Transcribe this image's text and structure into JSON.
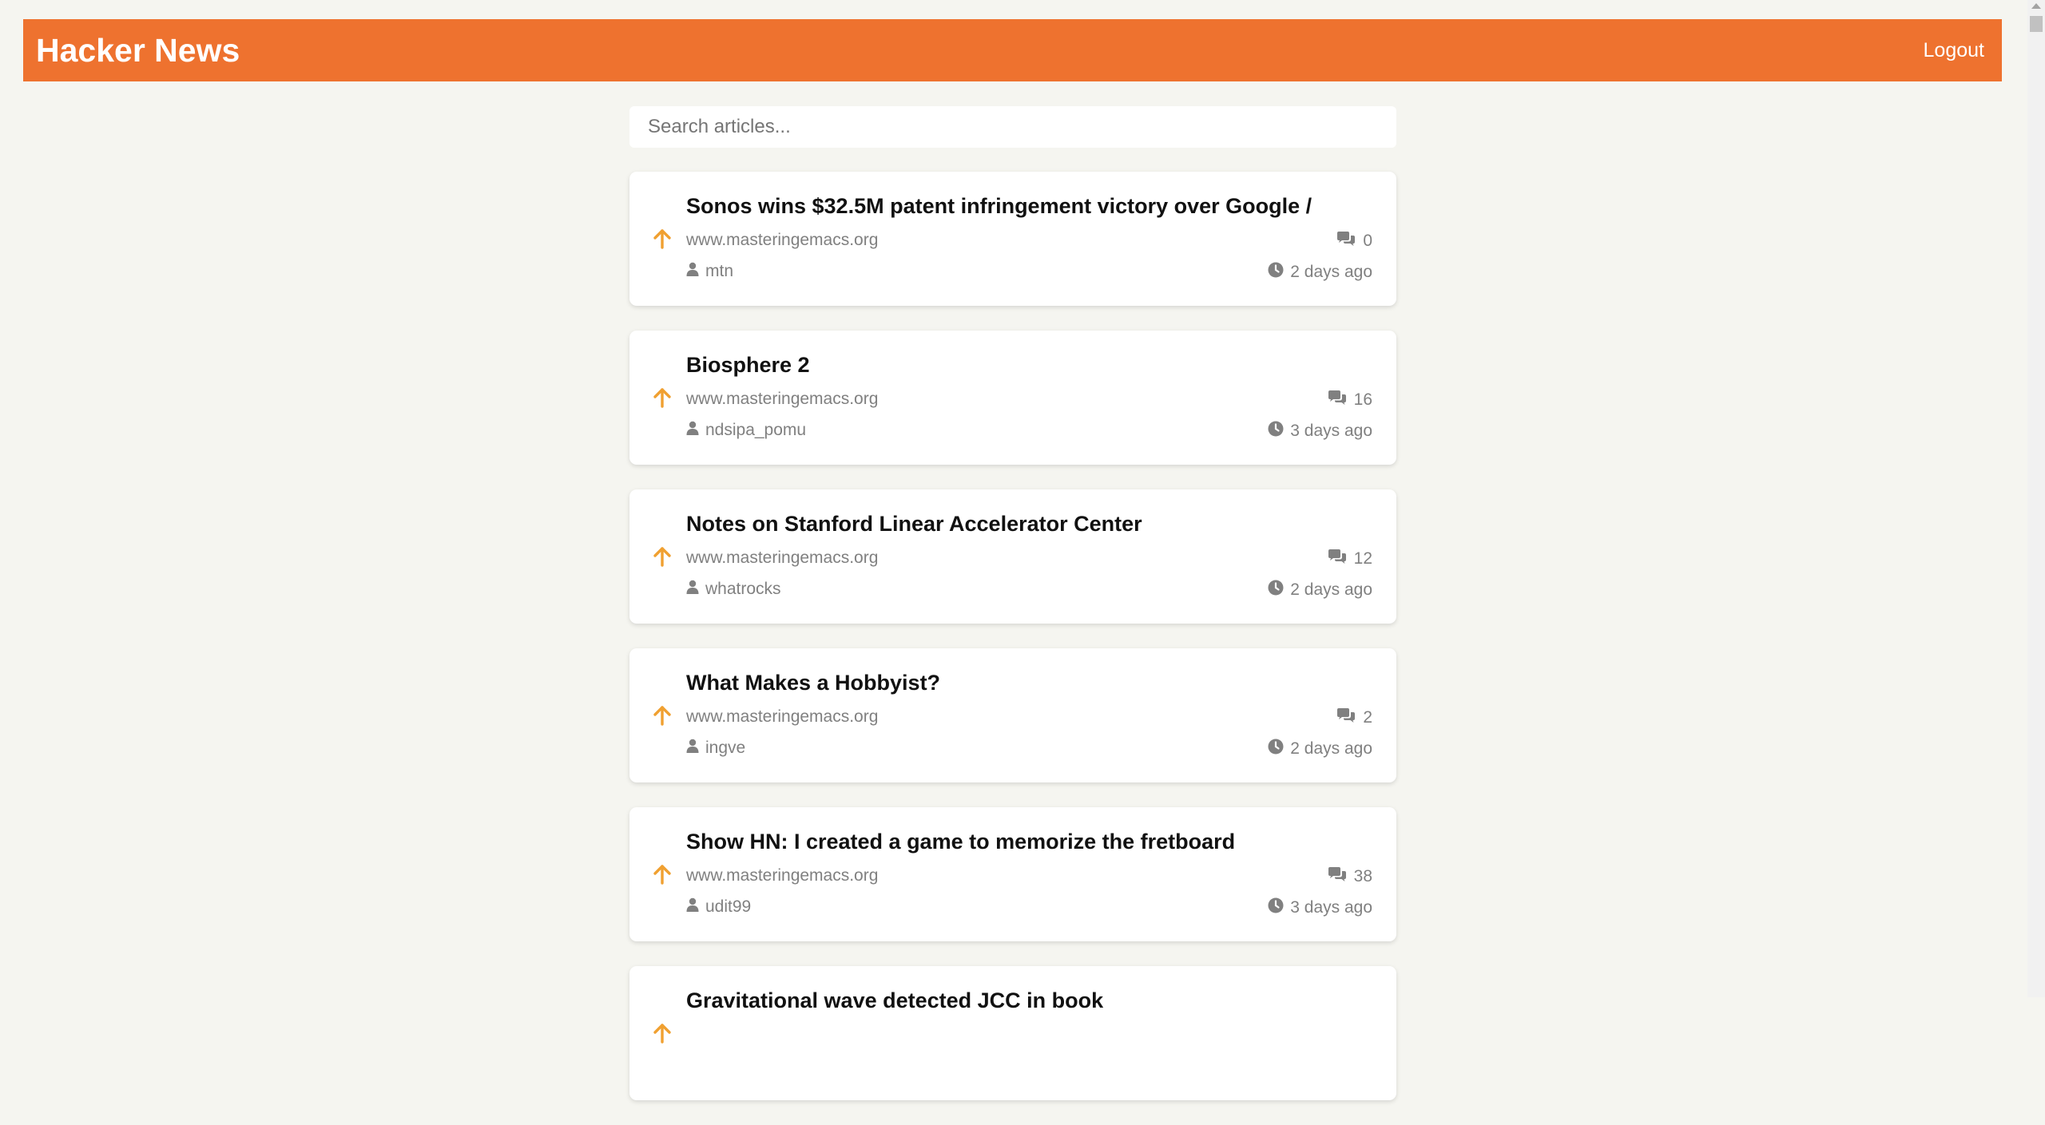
{
  "header": {
    "title": "Hacker News",
    "logout_label": "Logout"
  },
  "search": {
    "placeholder": "Search articles..."
  },
  "colors": {
    "brand": "#ee722f",
    "upvote": "#f0a030",
    "meta": "#808080"
  },
  "icons": {
    "upvote": "upvote-arrow-icon",
    "comments": "comments-icon",
    "author": "user-icon",
    "time": "clock-icon"
  },
  "articles": [
    {
      "title": "Sonos wins $32.5M patent infringement victory over Google /",
      "domain": "www.masteringemacs.org",
      "author": "mtn",
      "comments": "0",
      "time": "2 days ago"
    },
    {
      "title": "Biosphere 2",
      "domain": "www.masteringemacs.org",
      "author": "ndsipa_pomu",
      "comments": "16",
      "time": "3 days ago"
    },
    {
      "title": "Notes on Stanford Linear Accelerator Center",
      "domain": "www.masteringemacs.org",
      "author": "whatrocks",
      "comments": "12",
      "time": "2 days ago"
    },
    {
      "title": "What Makes a Hobbyist?",
      "domain": "www.masteringemacs.org",
      "author": "ingve",
      "comments": "2",
      "time": "2 days ago"
    },
    {
      "title": "Show HN: I created a game to memorize the fretboard",
      "domain": "www.masteringemacs.org",
      "author": "udit99",
      "comments": "38",
      "time": "3 days ago"
    },
    {
      "title": "Gravitational wave detected JCC in book",
      "domain": "",
      "author": "",
      "comments": "",
      "time": ""
    }
  ]
}
